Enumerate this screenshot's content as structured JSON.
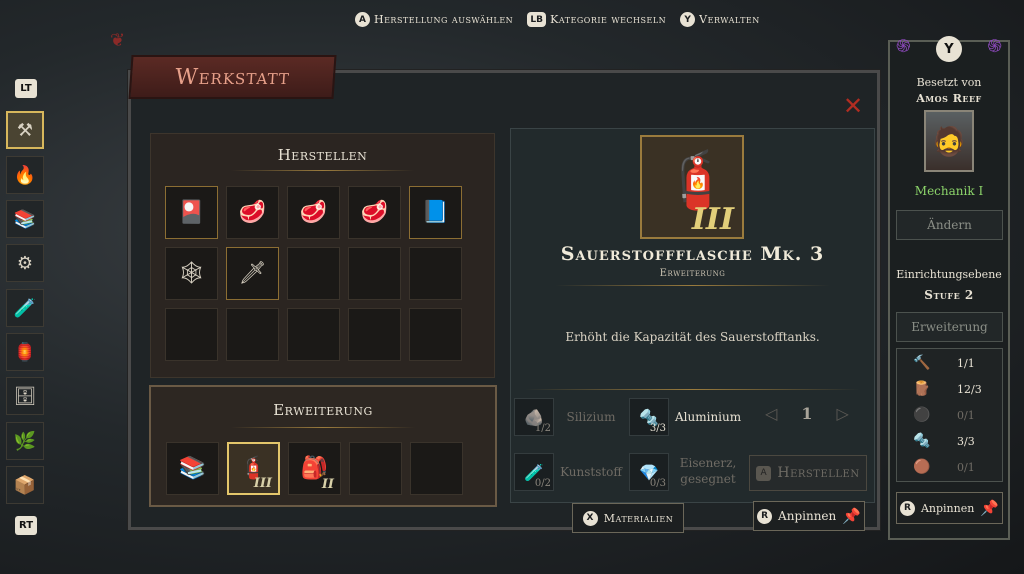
{
  "hints": [
    {
      "glyph": "A",
      "label": "Herstellung auswählen"
    },
    {
      "glyph": "LB",
      "label": "Kategorie wechseln"
    },
    {
      "glyph": "Y",
      "label": "Verwalten"
    }
  ],
  "rail": {
    "top_tag": "LT",
    "bottom_tag": "RT",
    "icons": [
      "workshop-icon",
      "furnace-icon",
      "bookshelf-icon",
      "forge-icon",
      "lab-icon",
      "lantern-icon",
      "cabinet-icon",
      "garden-icon",
      "storage-icon"
    ]
  },
  "panel": {
    "title": "Werkstatt"
  },
  "craft": {
    "title": "Herstellen",
    "slots": [
      {
        "icon": "🎴",
        "state": "gold"
      },
      {
        "icon": "🥩",
        "state": "normal"
      },
      {
        "icon": "🥩",
        "state": "normal"
      },
      {
        "icon": "🥩",
        "state": "normal"
      },
      {
        "icon": "📘",
        "state": "gold"
      },
      {
        "icon": "🕸",
        "state": "normal"
      },
      {
        "icon": "🗡",
        "state": "gold"
      },
      {
        "icon": "",
        "state": "normal"
      },
      {
        "icon": "",
        "state": "normal"
      },
      {
        "icon": "",
        "state": "normal"
      },
      {
        "icon": "",
        "state": "normal"
      },
      {
        "icon": "",
        "state": "normal"
      },
      {
        "icon": "",
        "state": "normal"
      },
      {
        "icon": "",
        "state": "normal"
      },
      {
        "icon": "",
        "state": "normal"
      }
    ]
  },
  "upgrade": {
    "title": "Erweiterung",
    "slots": [
      {
        "icon": "📚",
        "tier": "",
        "state": "normal"
      },
      {
        "icon": "🧯",
        "tier": "III",
        "state": "selected"
      },
      {
        "icon": "🎒",
        "tier": "II",
        "state": "normal"
      },
      {
        "icon": "",
        "tier": "",
        "state": "normal"
      },
      {
        "icon": "",
        "tier": "",
        "state": "normal"
      }
    ]
  },
  "detail": {
    "icon": "🧯",
    "tier": "III",
    "name": "Sauerstoffflasche Mk. 3",
    "type": "Erweiterung",
    "description": "Erhöht die Kapazität des Sauerstofftanks.",
    "materials": [
      {
        "name": "Silizium",
        "count": "1/2",
        "ok": false,
        "icon": "🪨"
      },
      {
        "name": "Aluminium",
        "count": "3/3",
        "ok": true,
        "icon": "🔩"
      },
      {
        "name": "Kunststoff",
        "count": "0/2",
        "ok": false,
        "icon": "🧪"
      },
      {
        "name": "Eisenerz, gesegnet",
        "count": "0/3",
        "ok": false,
        "icon": "💎"
      }
    ],
    "quantity": "1",
    "craft_glyph": "A",
    "craft_label": "Herstellen"
  },
  "bottom": {
    "materials_glyph": "X",
    "materials_label": "Materialien",
    "pin_glyph": "R",
    "pin_label": "Anpinnen"
  },
  "side": {
    "occupied_label": "Besetzt von",
    "occupant": "Amos Reef",
    "role": "Mechanik I",
    "change_label": "Ändern",
    "level_label": "Einrichtungsebene",
    "level_value": "Stufe 2",
    "upgrade_label": "Erweiterung",
    "resources": [
      {
        "icon": "🔨",
        "value": "1/1",
        "ok": true
      },
      {
        "icon": "🪵",
        "value": "12/3",
        "ok": true
      },
      {
        "icon": "⚫",
        "value": "0/1",
        "ok": false
      },
      {
        "icon": "🔩",
        "value": "3/3",
        "ok": true
      },
      {
        "icon": "🟤",
        "value": "0/1",
        "ok": false
      }
    ],
    "pin_glyph": "R",
    "pin_label": "Anpinnen",
    "y_glyph": "Y"
  },
  "colors": {
    "accent_gold": "#d7b75c",
    "pin_red": "#c9302c",
    "role_green": "#8cd46a",
    "close_red": "#b12d22"
  }
}
